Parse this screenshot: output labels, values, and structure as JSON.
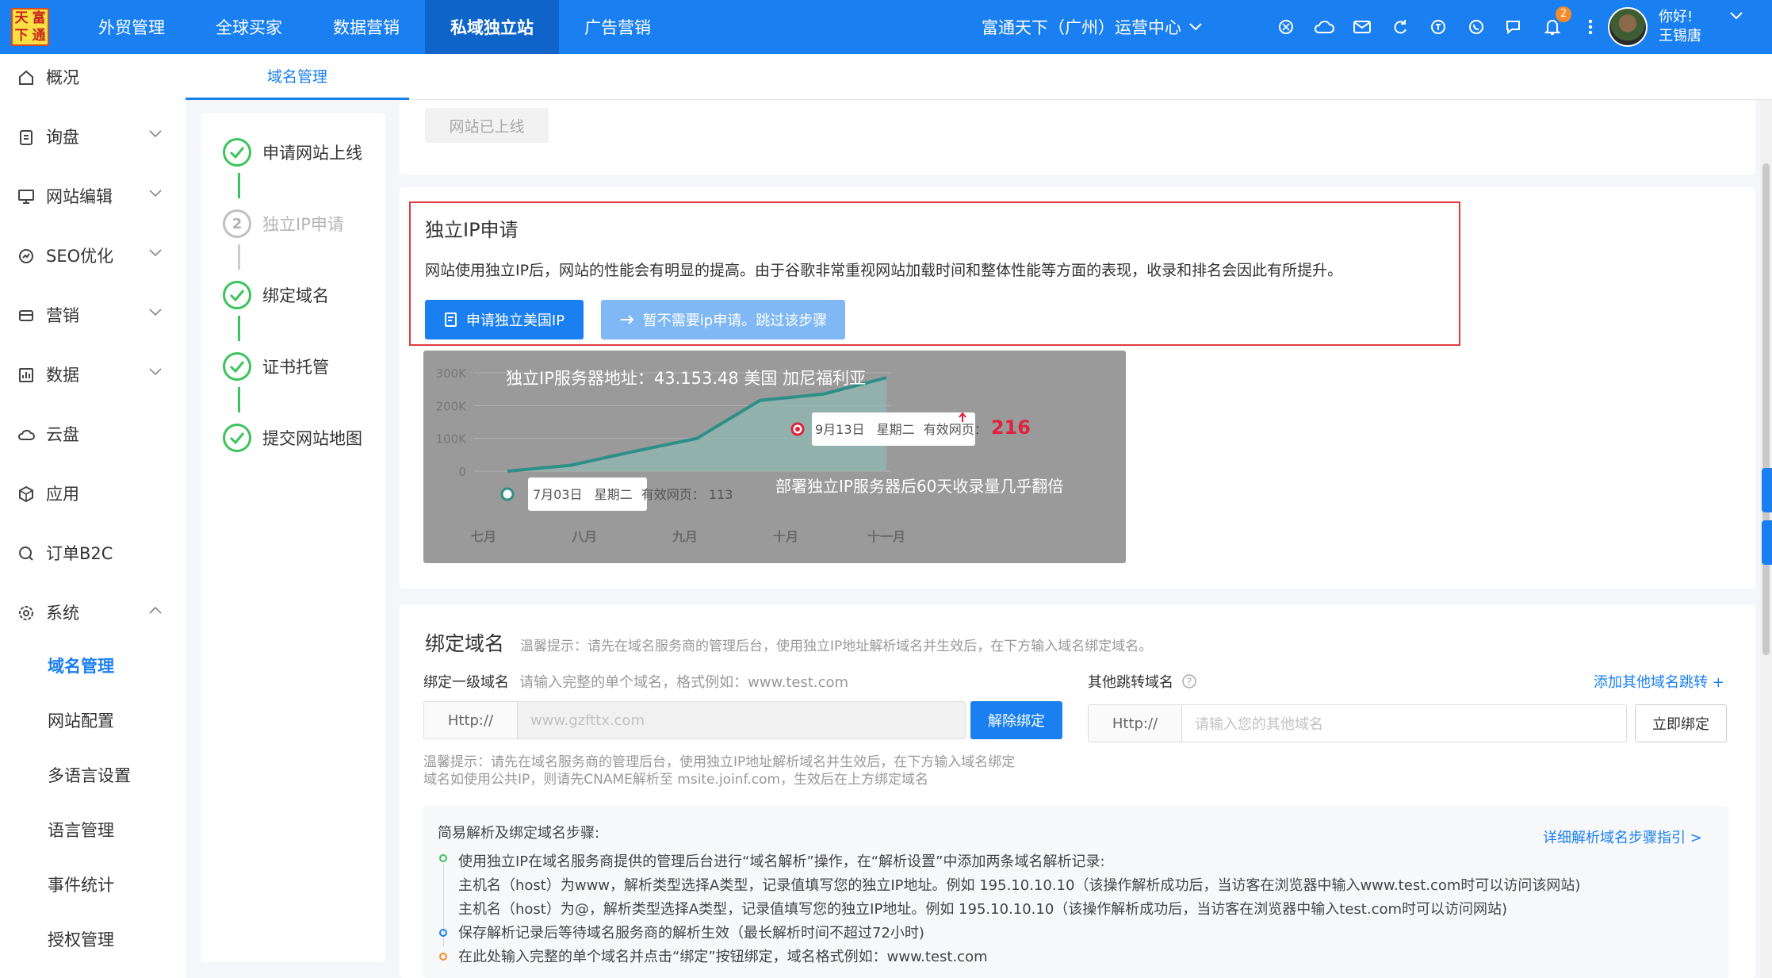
{
  "brand": {
    "logo_chars": [
      "天",
      "富",
      "下",
      "通"
    ]
  },
  "topnav": {
    "items": [
      "外贸管理",
      "全球买家",
      "数据营销",
      "私域独立站",
      "广告营销"
    ],
    "active_index": 3,
    "center_select": "富通天下（广州）运营中心",
    "notification_count": "2"
  },
  "user": {
    "greeting": "你好!",
    "name": "王锡唐"
  },
  "sidebar": {
    "items": [
      {
        "label": "概况",
        "icon": "home-icon"
      },
      {
        "label": "询盘",
        "icon": "clipboard-icon"
      },
      {
        "label": "网站编辑",
        "icon": "monitor-icon"
      },
      {
        "label": "SEO优化",
        "icon": "seo-icon"
      },
      {
        "label": "营销",
        "icon": "marketing-icon"
      },
      {
        "label": "数据",
        "icon": "chart-icon"
      },
      {
        "label": "云盘",
        "icon": "cloud-icon"
      },
      {
        "label": "应用",
        "icon": "cube-icon"
      },
      {
        "label": "订单B2C",
        "icon": "order-icon"
      },
      {
        "label": "系统",
        "icon": "settings-icon"
      }
    ],
    "system_sub": [
      "域名管理",
      "网站配置",
      "多语言设置",
      "语言管理",
      "事件统计",
      "授权管理"
    ],
    "active_sub": "域名管理"
  },
  "tab": {
    "label": "域名管理"
  },
  "steps": [
    {
      "label": "申请网站上线",
      "status": "done"
    },
    {
      "label": "独立IP申请",
      "status": "pending",
      "number": "2"
    },
    {
      "label": "绑定域名",
      "status": "done"
    },
    {
      "label": "证书托管",
      "status": "done"
    },
    {
      "label": "提交网站地图",
      "status": "done"
    }
  ],
  "online_badge": "网站已上线",
  "ip_apply": {
    "title": "独立IP申请",
    "desc": "网站使用独立IP后，网站的性能会有明显的提高。由于谷歌非常重视网站加载时间和整体性能等方面的表现，收录和排名会因此有所提升。",
    "apply_button": "申请独立美国IP",
    "skip_button": "暂不需要ip申请。跳过该步骤"
  },
  "chart_data": {
    "type": "area",
    "title": "独立IP服务器地址：43.153.48   美国  加尼福利亚",
    "annotation": "部署独立IP服务器后60天收录量几乎翻倍",
    "x": [
      "七月",
      "八月",
      "九月",
      "十月",
      "十一月"
    ],
    "y_ticks": [
      "300K",
      "200K",
      "100K",
      "0"
    ],
    "ylim": [
      0,
      300000
    ],
    "series": [
      {
        "values": [
          113,
          18000,
          60000,
          100000,
          216000,
          235000,
          285000
        ]
      }
    ],
    "callouts": [
      {
        "date": "7月03日",
        "weekday": "星期二",
        "label": "有效网页：",
        "value": "113"
      },
      {
        "date": "9月13日",
        "weekday": "星期二",
        "label": "有效网页：",
        "value": "216"
      }
    ]
  },
  "bind": {
    "title": "绑定域名",
    "hint": "温馨提示：请先在域名服务商的管理后台，使用独立IP地址解析域名并生效后，在下方输入域名绑定域名。",
    "primary_label": "绑定一级域名",
    "primary_sub": "请输入完整的单个域名，格式例如：www.test.com",
    "prefix": "Http://",
    "primary_value": "www.gzfttx.com",
    "unbind_button": "解除绑定",
    "other_label": "其他跳转域名",
    "add_other": "添加其他域名跳转 +",
    "other_placeholder": "请输入您的其他域名",
    "bind_now_button": "立即绑定",
    "tip_line1": "温馨提示：请先在域名服务商的管理后台，使用独立IP地址解析域名并生效后，在下方输入域名绑定",
    "tip_line2": "域名如使用公共IP，则请先CNAME解析至 msite.joinf.com，生效后在上方绑定域名"
  },
  "resolve": {
    "title": "简易解析及绑定域名步骤:",
    "guide_link": "详细解析域名步骤指引 >",
    "lines": [
      "使用独立IP在域名服务商提供的管理后台进行“域名解析”操作，在“解析设置”中添加两条域名解析记录:",
      "主机名（host）为www，解析类型选择A类型，记录值填写您的独立IP地址。例如 195.10.10.10（该操作解析成功后，当访客在浏览器中输入www.test.com时可以访问该网站)",
      "主机名（host）为@，解析类型选择A类型，记录值填写您的独立IP地址。例如 195.10.10.10（该操作解析成功后，当访客在浏览器中输入test.com时可以访问网站)",
      "保存解析记录后等待域名服务商的解析生效（最长解析时间不超过72小时)",
      "在此处输入完整的单个域名并点击“绑定”按钮绑定，域名格式例如：www.test.com"
    ]
  },
  "colors": {
    "primary": "#1a7ff0",
    "success": "#3cc45c",
    "highlight_border": "#e33b3b",
    "chart_accent": "#e0223c"
  }
}
